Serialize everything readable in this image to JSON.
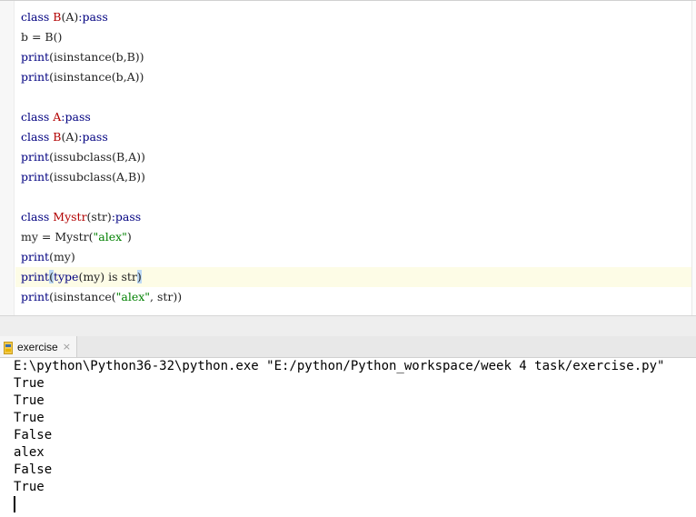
{
  "editor": {
    "lines": [
      {
        "t": [
          [
            "kw",
            "class "
          ],
          [
            "cls",
            "B"
          ],
          [
            "plain",
            "(A)"
          ],
          [
            "kw",
            ":pass"
          ]
        ]
      },
      {
        "t": [
          [
            "plain",
            "b = B()"
          ]
        ]
      },
      {
        "t": [
          [
            "kw",
            "print"
          ],
          [
            "plain",
            "(isinstance(b,B))"
          ]
        ]
      },
      {
        "t": [
          [
            "kw",
            "print"
          ],
          [
            "plain",
            "(isinstance(b,A))"
          ]
        ]
      },
      {
        "t": []
      },
      {
        "t": [
          [
            "kw",
            "class "
          ],
          [
            "cls",
            "A"
          ],
          [
            "kw",
            ":pass"
          ]
        ]
      },
      {
        "t": [
          [
            "kw",
            "class "
          ],
          [
            "cls",
            "B"
          ],
          [
            "plain",
            "(A)"
          ],
          [
            "kw",
            ":pass"
          ]
        ]
      },
      {
        "t": [
          [
            "kw",
            "print"
          ],
          [
            "plain",
            "(issubclass(B,A))"
          ]
        ]
      },
      {
        "t": [
          [
            "kw",
            "print"
          ],
          [
            "plain",
            "(issubclass(A,B))"
          ]
        ]
      },
      {
        "t": []
      },
      {
        "t": [
          [
            "kw",
            "class "
          ],
          [
            "cls",
            "Mystr"
          ],
          [
            "plain",
            "(str)"
          ],
          [
            "kw",
            ":pass"
          ]
        ]
      },
      {
        "t": [
          [
            "plain",
            "my = Mystr("
          ],
          [
            "str",
            "\"alex\""
          ],
          [
            "plain",
            ")"
          ]
        ]
      },
      {
        "t": [
          [
            "kw",
            "print"
          ],
          [
            "plain",
            "(my)"
          ]
        ]
      },
      {
        "t": [
          [
            "kw",
            "print"
          ],
          [
            "hl",
            "("
          ],
          [
            "kw",
            "type"
          ],
          [
            "plain",
            "(my) is str"
          ],
          [
            "hl",
            ")"
          ]
        ],
        "current": true
      },
      {
        "t": [
          [
            "kw",
            "print"
          ],
          [
            "plain",
            "(isinstance("
          ],
          [
            "str",
            "\"alex\""
          ],
          [
            "plain",
            ", str))"
          ]
        ]
      }
    ]
  },
  "run_tab": {
    "label": "exercise",
    "icon": "python-file-icon",
    "close": "×"
  },
  "console": {
    "lines": [
      "E:\\python\\Python36-32\\python.exe \"E:/python/Python_workspace/week 4 task/exercise.py\"",
      "True",
      "True",
      "True",
      "False",
      "alex",
      "False",
      "True"
    ]
  },
  "colors": {
    "keyword": "#000080",
    "class_name": "#b20000",
    "string": "#008000",
    "current_line": "#fdfce6",
    "brace_match": "#bcd8f5"
  }
}
